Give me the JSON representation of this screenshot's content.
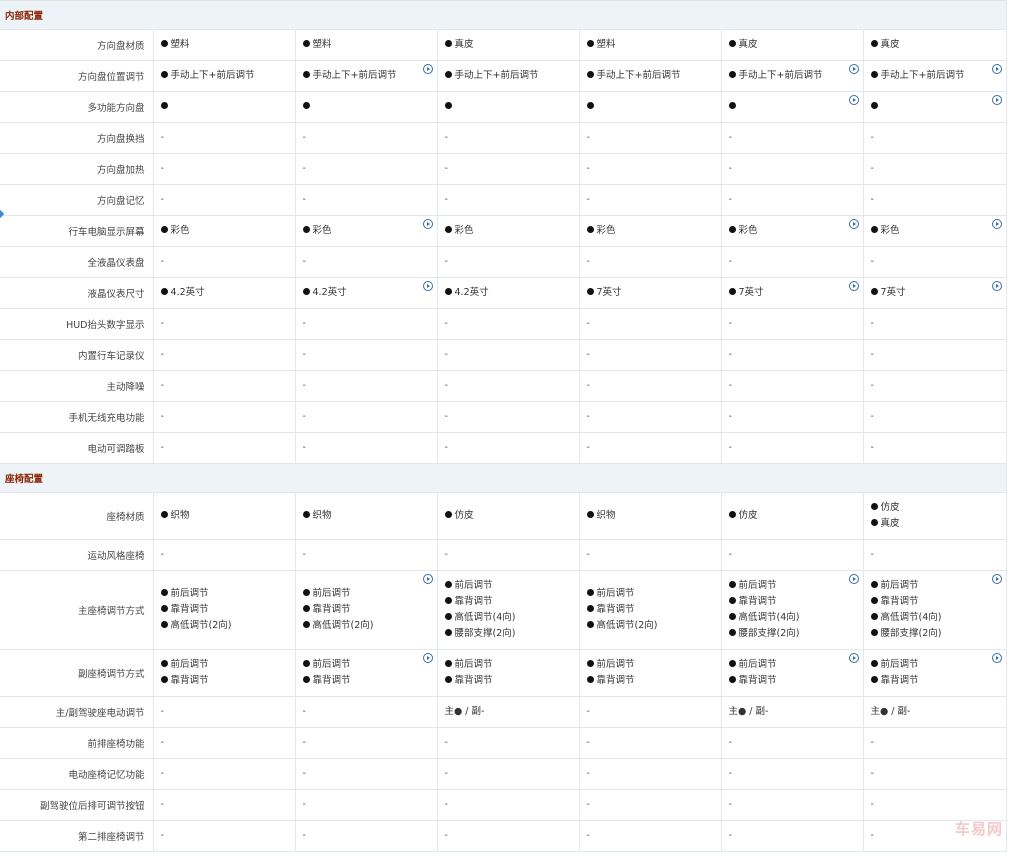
{
  "sections": [
    {
      "title": "内部配置",
      "rows": [
        {
          "label": "方向盘材质",
          "cells": [
            [
              "塑料"
            ],
            [
              "塑料"
            ],
            [
              "真皮"
            ],
            [
              "塑料"
            ],
            [
              "真皮"
            ],
            [
              "真皮"
            ]
          ],
          "dots": [
            [
              1
            ],
            [
              1
            ],
            [
              1
            ],
            [
              1
            ],
            [
              1
            ],
            [
              1
            ]
          ],
          "icons": [
            0,
            0,
            0,
            0,
            0,
            0
          ]
        },
        {
          "label": "方向盘位置调节",
          "cells": [
            [
              "手动上下+前后调节"
            ],
            [
              "手动上下+前后调节"
            ],
            [
              "手动上下+前后调节"
            ],
            [
              "手动上下+前后调节"
            ],
            [
              "手动上下+前后调节"
            ],
            [
              "手动上下+前后调节"
            ]
          ],
          "dots": [
            [
              1
            ],
            [
              1
            ],
            [
              1
            ],
            [
              1
            ],
            [
              1
            ],
            [
              1
            ]
          ],
          "icons": [
            0,
            1,
            0,
            0,
            1,
            1
          ]
        },
        {
          "label": "多功能方向盘",
          "cells": [
            [
              ""
            ],
            [
              ""
            ],
            [
              ""
            ],
            [
              ""
            ],
            [
              ""
            ],
            [
              ""
            ]
          ],
          "dots": [
            [
              1
            ],
            [
              1
            ],
            [
              1
            ],
            [
              1
            ],
            [
              1
            ],
            [
              1
            ]
          ],
          "icons": [
            0,
            0,
            0,
            0,
            1,
            1
          ]
        },
        {
          "label": "方向盘换挡",
          "cells": [
            [
              "-"
            ],
            [
              "-"
            ],
            [
              "-"
            ],
            [
              "-"
            ],
            [
              "-"
            ],
            [
              "-"
            ]
          ],
          "dots": [
            [
              0
            ],
            [
              0
            ],
            [
              0
            ],
            [
              0
            ],
            [
              0
            ],
            [
              0
            ]
          ],
          "icons": [
            0,
            0,
            0,
            0,
            0,
            0
          ]
        },
        {
          "label": "方向盘加热",
          "cells": [
            [
              "-"
            ],
            [
              "-"
            ],
            [
              "-"
            ],
            [
              "-"
            ],
            [
              "-"
            ],
            [
              "-"
            ]
          ],
          "dots": [
            [
              0
            ],
            [
              0
            ],
            [
              0
            ],
            [
              0
            ],
            [
              0
            ],
            [
              0
            ]
          ],
          "icons": [
            0,
            0,
            0,
            0,
            0,
            0
          ]
        },
        {
          "label": "方向盘记忆",
          "cells": [
            [
              "-"
            ],
            [
              "-"
            ],
            [
              "-"
            ],
            [
              "-"
            ],
            [
              "-"
            ],
            [
              "-"
            ]
          ],
          "dots": [
            [
              0
            ],
            [
              0
            ],
            [
              0
            ],
            [
              0
            ],
            [
              0
            ],
            [
              0
            ]
          ],
          "icons": [
            0,
            0,
            0,
            0,
            0,
            0
          ]
        },
        {
          "label": "行车电脑显示屏幕",
          "cells": [
            [
              "彩色"
            ],
            [
              "彩色"
            ],
            [
              "彩色"
            ],
            [
              "彩色"
            ],
            [
              "彩色"
            ],
            [
              "彩色"
            ]
          ],
          "dots": [
            [
              1
            ],
            [
              1
            ],
            [
              1
            ],
            [
              1
            ],
            [
              1
            ],
            [
              1
            ]
          ],
          "icons": [
            0,
            1,
            0,
            0,
            1,
            1
          ]
        },
        {
          "label": "全液晶仪表盘",
          "cells": [
            [
              "-"
            ],
            [
              "-"
            ],
            [
              "-"
            ],
            [
              "-"
            ],
            [
              "-"
            ],
            [
              "-"
            ]
          ],
          "dots": [
            [
              0
            ],
            [
              0
            ],
            [
              0
            ],
            [
              0
            ],
            [
              0
            ],
            [
              0
            ]
          ],
          "icons": [
            0,
            0,
            0,
            0,
            0,
            0
          ]
        },
        {
          "label": "液晶仪表尺寸",
          "cells": [
            [
              "4.2英寸"
            ],
            [
              "4.2英寸"
            ],
            [
              "4.2英寸"
            ],
            [
              "7英寸"
            ],
            [
              "7英寸"
            ],
            [
              "7英寸"
            ]
          ],
          "dots": [
            [
              1
            ],
            [
              1
            ],
            [
              1
            ],
            [
              1
            ],
            [
              1
            ],
            [
              1
            ]
          ],
          "icons": [
            0,
            1,
            0,
            0,
            1,
            1
          ]
        },
        {
          "label": "HUD抬头数字显示",
          "cells": [
            [
              "-"
            ],
            [
              "-"
            ],
            [
              "-"
            ],
            [
              "-"
            ],
            [
              "-"
            ],
            [
              "-"
            ]
          ],
          "dots": [
            [
              0
            ],
            [
              0
            ],
            [
              0
            ],
            [
              0
            ],
            [
              0
            ],
            [
              0
            ]
          ],
          "icons": [
            0,
            0,
            0,
            0,
            0,
            0
          ]
        },
        {
          "label": "内置行车记录仪",
          "cells": [
            [
              "-"
            ],
            [
              "-"
            ],
            [
              "-"
            ],
            [
              "-"
            ],
            [
              "-"
            ],
            [
              "-"
            ]
          ],
          "dots": [
            [
              0
            ],
            [
              0
            ],
            [
              0
            ],
            [
              0
            ],
            [
              0
            ],
            [
              0
            ]
          ],
          "icons": [
            0,
            0,
            0,
            0,
            0,
            0
          ]
        },
        {
          "label": "主动降噪",
          "cells": [
            [
              "-"
            ],
            [
              "-"
            ],
            [
              "-"
            ],
            [
              "-"
            ],
            [
              "-"
            ],
            [
              "-"
            ]
          ],
          "dots": [
            [
              0
            ],
            [
              0
            ],
            [
              0
            ],
            [
              0
            ],
            [
              0
            ],
            [
              0
            ]
          ],
          "icons": [
            0,
            0,
            0,
            0,
            0,
            0
          ]
        },
        {
          "label": "手机无线充电功能",
          "cells": [
            [
              "-"
            ],
            [
              "-"
            ],
            [
              "-"
            ],
            [
              "-"
            ],
            [
              "-"
            ],
            [
              "-"
            ]
          ],
          "dots": [
            [
              0
            ],
            [
              0
            ],
            [
              0
            ],
            [
              0
            ],
            [
              0
            ],
            [
              0
            ]
          ],
          "icons": [
            0,
            0,
            0,
            0,
            0,
            0
          ]
        },
        {
          "label": "电动可调踏板",
          "cells": [
            [
              "-"
            ],
            [
              "-"
            ],
            [
              "-"
            ],
            [
              "-"
            ],
            [
              "-"
            ],
            [
              "-"
            ]
          ],
          "dots": [
            [
              0
            ],
            [
              0
            ],
            [
              0
            ],
            [
              0
            ],
            [
              0
            ],
            [
              0
            ]
          ],
          "icons": [
            0,
            0,
            0,
            0,
            0,
            0
          ]
        }
      ]
    },
    {
      "title": "座椅配置",
      "rows": [
        {
          "label": "座椅材质",
          "cls": "r2",
          "cells": [
            [
              "织物"
            ],
            [
              "织物"
            ],
            [
              "仿皮"
            ],
            [
              "织物"
            ],
            [
              "仿皮"
            ],
            [
              "仿皮",
              "真皮"
            ]
          ],
          "dots": [
            [
              1
            ],
            [
              1
            ],
            [
              1
            ],
            [
              1
            ],
            [
              1
            ],
            [
              1,
              1
            ]
          ],
          "icons": [
            0,
            0,
            0,
            0,
            0,
            0
          ]
        },
        {
          "label": "运动风格座椅",
          "cells": [
            [
              "-"
            ],
            [
              "-"
            ],
            [
              "-"
            ],
            [
              "-"
            ],
            [
              "-"
            ],
            [
              "-"
            ]
          ],
          "dots": [
            [
              0
            ],
            [
              0
            ],
            [
              0
            ],
            [
              0
            ],
            [
              0
            ],
            [
              0
            ]
          ],
          "icons": [
            0,
            0,
            0,
            0,
            0,
            0
          ]
        },
        {
          "label": "主座椅调节方式",
          "cls": "r4",
          "cells": [
            [
              "前后调节",
              "靠背调节",
              "高低调节(2向)"
            ],
            [
              "前后调节",
              "靠背调节",
              "高低调节(2向)"
            ],
            [
              "前后调节",
              "靠背调节",
              "高低调节(4向)",
              "腰部支撑(2向)"
            ],
            [
              "前后调节",
              "靠背调节",
              "高低调节(2向)"
            ],
            [
              "前后调节",
              "靠背调节",
              "高低调节(4向)",
              "腰部支撑(2向)"
            ],
            [
              "前后调节",
              "靠背调节",
              "高低调节(4向)",
              "腰部支撑(2向)"
            ]
          ],
          "dots": [
            [
              1,
              1,
              1
            ],
            [
              1,
              1,
              1
            ],
            [
              1,
              1,
              1,
              1
            ],
            [
              1,
              1,
              1
            ],
            [
              1,
              1,
              1,
              1
            ],
            [
              1,
              1,
              1,
              1
            ]
          ],
          "icons": [
            0,
            1,
            0,
            0,
            1,
            1
          ]
        },
        {
          "label": "副座椅调节方式",
          "cls": "r5",
          "cells": [
            [
              "前后调节",
              "靠背调节"
            ],
            [
              "前后调节",
              "靠背调节"
            ],
            [
              "前后调节",
              "靠背调节"
            ],
            [
              "前后调节",
              "靠背调节"
            ],
            [
              "前后调节",
              "靠背调节"
            ],
            [
              "前后调节",
              "靠背调节"
            ]
          ],
          "dots": [
            [
              1,
              1
            ],
            [
              1,
              1
            ],
            [
              1,
              1
            ],
            [
              1,
              1
            ],
            [
              1,
              1
            ],
            [
              1,
              1
            ]
          ],
          "icons": [
            0,
            1,
            0,
            0,
            1,
            1
          ]
        },
        {
          "label": "主/副驾驶座电动调节",
          "cells": [
            [
              "-"
            ],
            [
              "-"
            ],
            [
              "主● / 副-"
            ],
            [
              "-"
            ],
            [
              "主● / 副-"
            ],
            [
              "主● / 副-"
            ]
          ],
          "dots": [
            [
              0
            ],
            [
              0
            ],
            [
              0
            ],
            [
              0
            ],
            [
              0
            ],
            [
              0
            ]
          ],
          "icons": [
            0,
            0,
            0,
            0,
            0,
            0
          ]
        },
        {
          "label": "前排座椅功能",
          "cells": [
            [
              "-"
            ],
            [
              "-"
            ],
            [
              "-"
            ],
            [
              "-"
            ],
            [
              "-"
            ],
            [
              "-"
            ]
          ],
          "dots": [
            [
              0
            ],
            [
              0
            ],
            [
              0
            ],
            [
              0
            ],
            [
              0
            ],
            [
              0
            ]
          ],
          "icons": [
            0,
            0,
            0,
            0,
            0,
            0
          ]
        },
        {
          "label": "电动座椅记忆功能",
          "cells": [
            [
              "-"
            ],
            [
              "-"
            ],
            [
              "-"
            ],
            [
              "-"
            ],
            [
              "-"
            ],
            [
              "-"
            ]
          ],
          "dots": [
            [
              0
            ],
            [
              0
            ],
            [
              0
            ],
            [
              0
            ],
            [
              0
            ],
            [
              0
            ]
          ],
          "icons": [
            0,
            0,
            0,
            0,
            0,
            0
          ]
        },
        {
          "label": "副驾驶位后排可调节按钮",
          "cells": [
            [
              "-"
            ],
            [
              "-"
            ],
            [
              "-"
            ],
            [
              "-"
            ],
            [
              "-"
            ],
            [
              "-"
            ]
          ],
          "dots": [
            [
              0
            ],
            [
              0
            ],
            [
              0
            ],
            [
              0
            ],
            [
              0
            ],
            [
              0
            ]
          ],
          "icons": [
            0,
            0,
            0,
            0,
            0,
            0
          ]
        },
        {
          "label": "第二排座椅调节",
          "cells": [
            [
              "-"
            ],
            [
              "-"
            ],
            [
              "-"
            ],
            [
              "-"
            ],
            [
              "-"
            ],
            [
              "-"
            ]
          ],
          "dots": [
            [
              0
            ],
            [
              0
            ],
            [
              0
            ],
            [
              0
            ],
            [
              0
            ],
            [
              0
            ]
          ],
          "icons": [
            0,
            0,
            0,
            0,
            0,
            0
          ]
        }
      ]
    }
  ],
  "icons": {
    "available_dot": "filled-circle",
    "detail_icon": "play-circle-icon"
  },
  "colors": {
    "section_title": "#8b2b0b",
    "section_bg": "#eef3f8",
    "border": "#e3e8ee",
    "link_blue": "#3a6ea5"
  },
  "watermark": "车易网"
}
